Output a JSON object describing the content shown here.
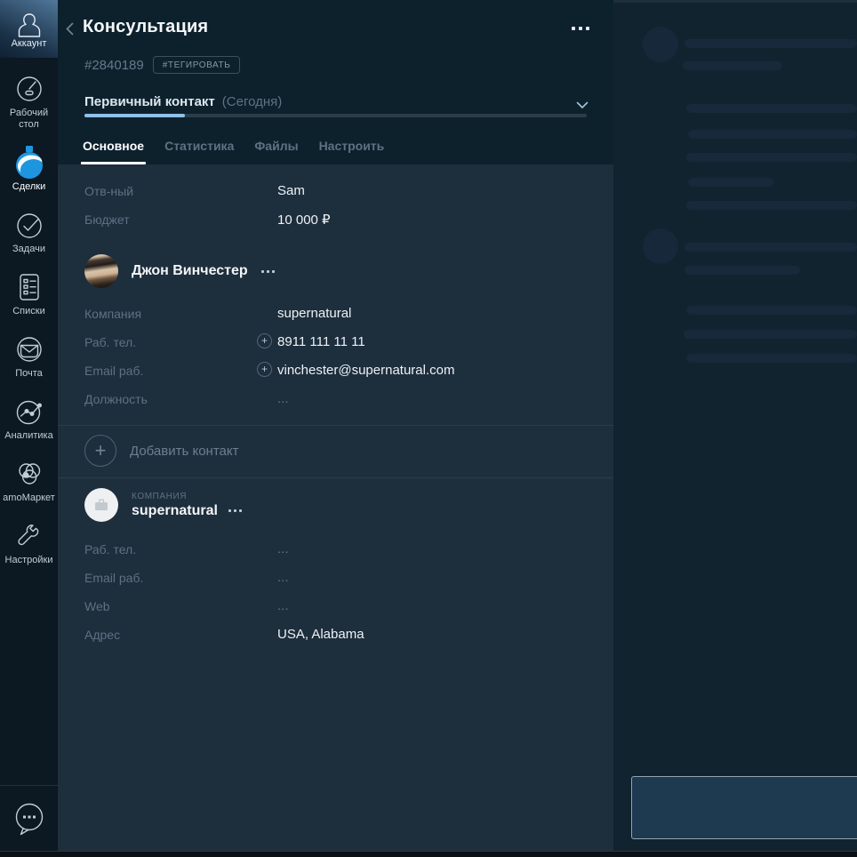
{
  "sidebar": {
    "account_label": "Аккаунт",
    "items": [
      {
        "label": "Рабочий стол",
        "icon": "dashboard-icon"
      },
      {
        "label": "Сделки",
        "icon": "deals-icon",
        "active": true
      },
      {
        "label": "Задачи",
        "icon": "tasks-icon"
      },
      {
        "label": "Списки",
        "icon": "lists-icon"
      },
      {
        "label": "Почта",
        "icon": "mail-icon"
      },
      {
        "label": "Аналитика",
        "icon": "analytics-icon"
      },
      {
        "label": "amoМаркет",
        "icon": "market-icon"
      },
      {
        "label": "Настройки",
        "icon": "settings-icon"
      }
    ]
  },
  "header": {
    "title": "Консультация",
    "lead_id": "#2840189",
    "tag_button_label": "#ТЕГИРОВАТЬ",
    "stage_name": "Первичный контакт",
    "stage_date": "(Сегодня)",
    "progress_percent": 20
  },
  "tabs": [
    {
      "label": "Основное",
      "active": true
    },
    {
      "label": "Статистика",
      "active": false
    },
    {
      "label": "Файлы",
      "active": false
    },
    {
      "label": "Настроить",
      "active": false
    }
  ],
  "main": {
    "deal_fields": [
      {
        "label": "Отв-ный",
        "value": "Sam"
      },
      {
        "label": "Бюджет",
        "value": "10 000 ₽"
      }
    ],
    "contact": {
      "name": "Джон Винчестер",
      "fields": [
        {
          "label": "Компания",
          "value": "supernatural"
        },
        {
          "label": "Раб. тел.",
          "value": "8911 111 11 11",
          "addable": true
        },
        {
          "label": "Email раб.",
          "value": "vinchester@supernatural.com",
          "addable": true
        },
        {
          "label": "Должность",
          "value": "..."
        }
      ]
    },
    "add_contact_label": "Добавить контакт",
    "company": {
      "type_label": "КОМПАНИЯ",
      "name": "supernatural",
      "fields": [
        {
          "label": "Раб. тел.",
          "value": "..."
        },
        {
          "label": "Email раб.",
          "value": "..."
        },
        {
          "label": "Web",
          "value": "..."
        },
        {
          "label": "Адрес",
          "value": "USA, Alabama"
        }
      ]
    }
  },
  "colors": {
    "accent_blue": "#1e96df",
    "progress_blue": "#8fc1ea",
    "header_bg": "#0d212d",
    "content_bg": "#1d2e3d",
    "sidebar_bg": "#0c1822",
    "feed_bg": "#11232f"
  }
}
